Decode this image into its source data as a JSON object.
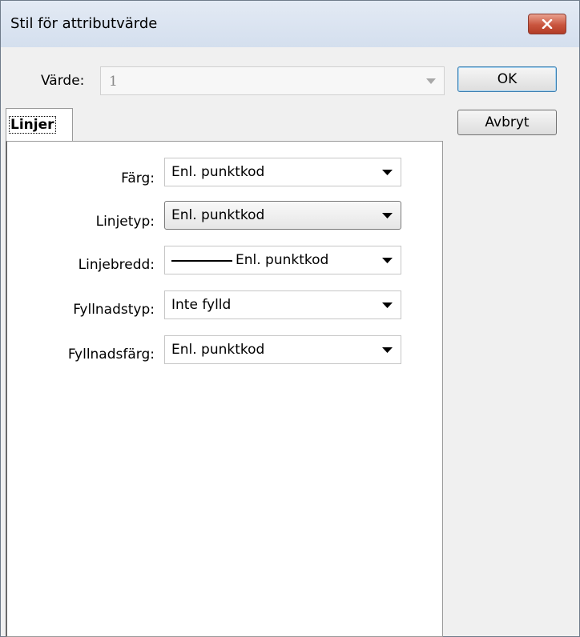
{
  "window": {
    "title": "Stil för attributvärde"
  },
  "value_field": {
    "label": "Värde:",
    "value": "1"
  },
  "buttons": {
    "ok": "OK",
    "cancel": "Avbryt"
  },
  "tab": {
    "label": "Linjer"
  },
  "rows": [
    {
      "label": "Färg:",
      "value": "Enl. punktkod"
    },
    {
      "label": "Linjetyp:",
      "value": "Enl. punktkod"
    },
    {
      "label": "Linjebredd:",
      "value": "Enl. punktkod"
    },
    {
      "label": "Fyllnadstyp:",
      "value": "Inte fylld"
    },
    {
      "label": "Fyllnadsfärg:",
      "value": "Enl. punktkod"
    }
  ],
  "icons": {
    "close": "close-icon",
    "dropdown": "chevron-down-icon"
  }
}
